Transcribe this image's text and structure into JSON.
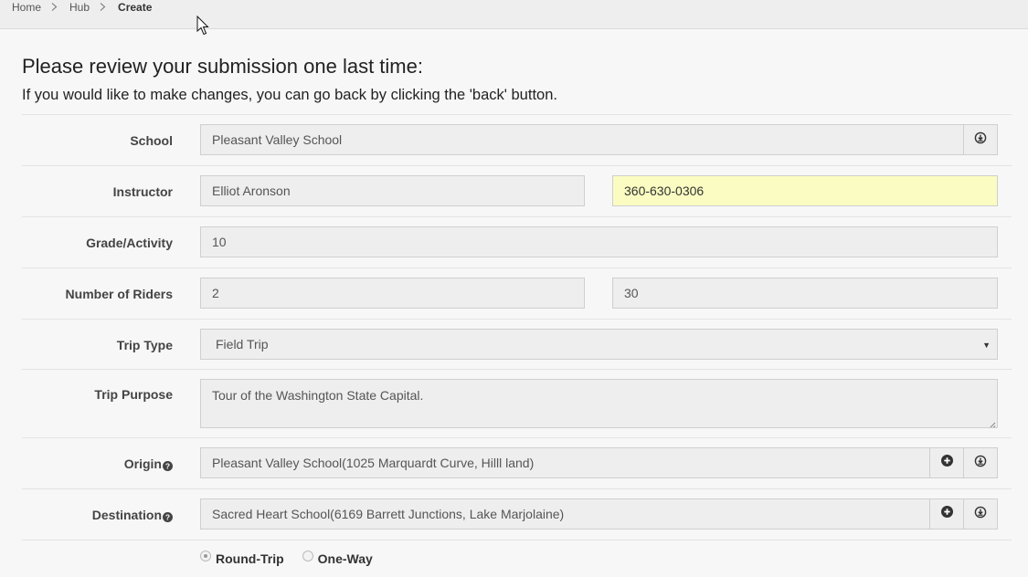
{
  "breadcrumb": {
    "items": [
      "Home",
      "Hub",
      "Create"
    ]
  },
  "header": {
    "title": "Please review your submission one last time:",
    "subtitle": "If you would like to make changes, you can go back by clicking the 'back' button."
  },
  "form": {
    "school": {
      "label": "School",
      "value": "Pleasant Valley School"
    },
    "instructor": {
      "label": "Instructor",
      "name": "Elliot Aronson",
      "phone": "360-630-0306"
    },
    "grade": {
      "label": "Grade/Activity",
      "value": "10"
    },
    "riders": {
      "label": "Number of Riders",
      "min": "2",
      "max": "30"
    },
    "trip_type": {
      "label": "Trip Type",
      "value": "Field Trip"
    },
    "trip_purpose": {
      "label": "Trip Purpose",
      "value": "Tour of the Washington State Capital."
    },
    "origin": {
      "label": "Origin",
      "value": "Pleasant Valley School(1025 Marquardt Curve, Hilll land)"
    },
    "destination": {
      "label": "Destination",
      "value": "Sacred Heart School(6169 Barrett Junctions, Lake Marjolaine)"
    },
    "trip_direction": {
      "options": [
        "Round-Trip",
        "One-Way"
      ],
      "selected": "Round-Trip"
    }
  },
  "colors": {
    "highlight_field": "#fafcc1",
    "field_background": "#eeeeee",
    "page_background": "#f7f7f7"
  },
  "icons": {
    "select_caret": "caret-down-icon",
    "add": "plus-circle-icon",
    "download": "download-circle-icon",
    "help": "question-circle-icon"
  }
}
